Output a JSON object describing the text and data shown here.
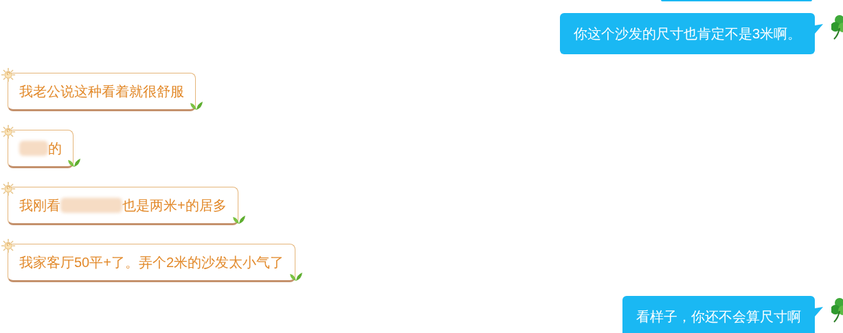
{
  "messages": [
    {
      "kind": "sent",
      "parts": [
        {
          "kind": "text",
          "text": "你这个沙发的尺寸也肯定不是3米啊。"
        }
      ]
    },
    {
      "kind": "received",
      "parts": [
        {
          "kind": "text",
          "text": "我老公说这种看着就很舒服"
        }
      ]
    },
    {
      "kind": "received",
      "parts": [
        {
          "kind": "redacted"
        },
        {
          "kind": "text",
          "text": "的"
        }
      ]
    },
    {
      "kind": "received",
      "parts": [
        {
          "kind": "text",
          "text": "我刚看"
        },
        {
          "kind": "redacted"
        },
        {
          "kind": "text",
          "text": "也是两米+的居多"
        }
      ]
    },
    {
      "kind": "received",
      "parts": [
        {
          "kind": "text",
          "text": "我家客厅50平+了。弄个2米的沙发太小气了"
        }
      ]
    },
    {
      "kind": "sent",
      "parts": [
        {
          "kind": "text",
          "text": "看样子，你还不会算尺寸啊"
        }
      ]
    }
  ]
}
